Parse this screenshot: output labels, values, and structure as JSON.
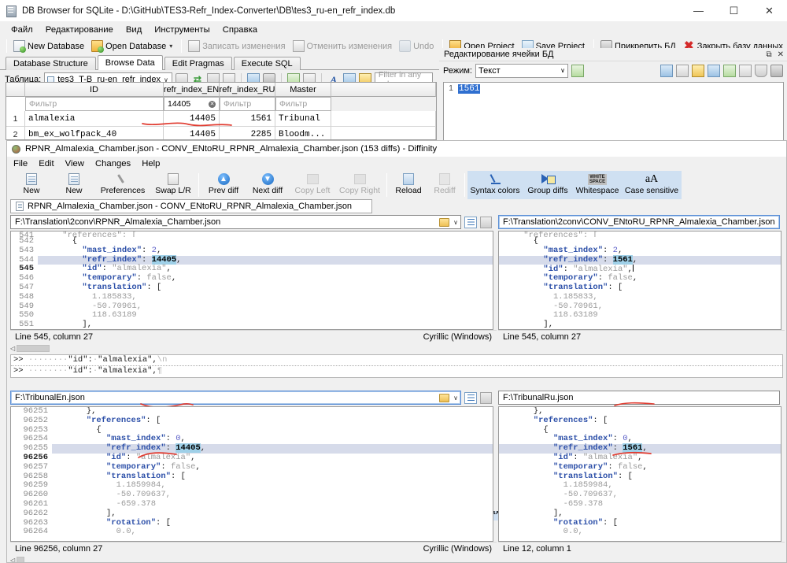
{
  "sqlite": {
    "title": "DB Browser for SQLite - D:\\GitHub\\TES3-Refr_Index-Converter\\DB\\tes3_ru-en_refr_index.db",
    "window_buttons": {
      "minimize": "—",
      "maximize": "☐",
      "close": "✕"
    },
    "menu": [
      "Файл",
      "Редактирование",
      "Вид",
      "Инструменты",
      "Справка"
    ],
    "toolbar": [
      {
        "label": "New Database",
        "icon": "new-database-icon"
      },
      {
        "label": "Open Database",
        "icon": "open-database-icon",
        "caret": "▾"
      },
      {
        "label": "Записать изменения",
        "icon": "write-changes-icon",
        "disabled": true
      },
      {
        "label": "Отменить изменения",
        "icon": "revert-changes-icon",
        "disabled": true
      },
      {
        "label": "Undo",
        "icon": "undo-icon",
        "disabled": true
      },
      {
        "label": "Open Project",
        "icon": "open-project-icon"
      },
      {
        "label": "Save Project",
        "icon": "save-project-icon"
      },
      {
        "label": "Прикрепить БД",
        "icon": "attach-database-icon"
      },
      {
        "label": "Закрыть базу данных",
        "icon": "close-database-icon"
      }
    ],
    "tabs": [
      {
        "label": "Database Structure",
        "active": false
      },
      {
        "label": "Browse Data",
        "active": true
      },
      {
        "label": "Edit Pragmas",
        "active": false
      },
      {
        "label": "Execute SQL",
        "active": false
      }
    ],
    "table_selector": {
      "label": "Таблица:",
      "value": "tes3_T-B_ru-en_refr_index",
      "caret": "∨"
    },
    "filter_any": {
      "placeholder": "Filter in any column",
      "value": ""
    },
    "grid": {
      "columns": [
        "ID",
        "refr_index_EN",
        "refr_index_RU",
        "Master"
      ],
      "filters": {
        "id": "Фильтр",
        "refr_index_en": "14405",
        "refr_index_ru": "Фильтр",
        "master": "Фильтр",
        "clear_glyph": "✕"
      },
      "rows": [
        {
          "n": "1",
          "id": "almalexia",
          "en": "14405",
          "ru": "1561",
          "master": "Tribunal"
        },
        {
          "n": "2",
          "id": "bm_ex_wolfpack_40",
          "en": "14405",
          "ru": "2285",
          "master": "Bloodm..."
        }
      ]
    },
    "cell_editor": {
      "title": "Редактирование ячейки БД",
      "undock_glyph": "⧉",
      "close_glyph": "✕",
      "mode_label": "Режим:",
      "mode_value": "Текст",
      "mode_caret": "∨",
      "line_number": "1",
      "content": "1561"
    }
  },
  "diffinity": {
    "title": "RPNR_Almalexia_Chamber.json - CONV_ENtoRU_RPNR_Almalexia_Chamber.json (153 diffs) - Diffinity",
    "menu": [
      "File",
      "Edit",
      "View",
      "Changes",
      "Help"
    ],
    "toolbar": [
      {
        "label": "New",
        "icon": "new-left-icon",
        "state": "normal"
      },
      {
        "label": "New",
        "icon": "new-right-icon",
        "state": "normal"
      },
      {
        "label": "Preferences",
        "icon": "wrench-icon",
        "state": "normal"
      },
      {
        "label": "Swap L/R",
        "icon": "swap-icon",
        "state": "normal"
      },
      {
        "label": "Prev diff",
        "icon": "arrow-up-icon",
        "state": "normal"
      },
      {
        "label": "Next diff",
        "icon": "arrow-down-icon",
        "state": "normal"
      },
      {
        "label": "Copy Left",
        "icon": "copy-left-icon",
        "state": "disabled"
      },
      {
        "label": "Copy Right",
        "icon": "copy-right-icon",
        "state": "disabled"
      },
      {
        "label": "Reload",
        "icon": "reload-icon",
        "state": "normal"
      },
      {
        "label": "Rediff",
        "icon": "rediff-icon",
        "state": "disabled"
      },
      {
        "label": "Syntax colors",
        "icon": "syntax-colors-icon",
        "state": "toggled"
      },
      {
        "label": "Group diffs",
        "icon": "group-diffs-icon",
        "state": "toggled"
      },
      {
        "label": "Whitespace",
        "icon": "whitespace-icon",
        "state": "toggled"
      },
      {
        "label": "Case sensitive",
        "icon": "case-sensitive-icon",
        "state": "toggled"
      }
    ],
    "doc_tab": "RPNR_Almalexia_Chamber.json - CONV_ENtoRU_RPNR_Almalexia_Chamber.json",
    "top": {
      "left": {
        "path": "F:\\Translation\\2conv\\RPNR_Almalexia_Chamber.json",
        "status_line": "Line 545, column 27",
        "encoding": "Cyrillic (Windows)",
        "lines": [
          {
            "no": "541",
            "clipped": true,
            "tokens": [
              [
                "s",
                "    \"references\": ["
              ]
            ]
          },
          {
            "no": "542",
            "tokens": [
              [
                "p",
                "      {"
              ]
            ]
          },
          {
            "no": "543",
            "tokens": [
              [
                "k",
                "        \"mast_index\""
              ],
              [
                "p",
                ": "
              ],
              [
                "n",
                "2"
              ],
              [
                "p",
                ","
              ]
            ]
          },
          {
            "no": "544",
            "highlight": true,
            "tokens": [
              [
                "k",
                "        \"refr_index\""
              ],
              [
                "p",
                ": "
              ],
              [
                "hl",
                "14405"
              ],
              [
                "p",
                ","
              ]
            ]
          },
          {
            "no": "545",
            "bold": true,
            "tokens": [
              [
                "k",
                "        \"id\""
              ],
              [
                "p",
                ": "
              ],
              [
                "s",
                "\"almalexia\""
              ],
              [
                "p",
                ","
              ]
            ]
          },
          {
            "no": "546",
            "tokens": [
              [
                "k",
                "        \"temporary\""
              ],
              [
                "p",
                ": "
              ],
              [
                "s",
                "false"
              ],
              [
                "p",
                ","
              ]
            ]
          },
          {
            "no": "547",
            "tokens": [
              [
                "k",
                "        \"translation\""
              ],
              [
                "p",
                ": ["
              ]
            ]
          },
          {
            "no": "548",
            "tokens": [
              [
                "s",
                "          1.185833,"
              ]
            ]
          },
          {
            "no": "549",
            "tokens": [
              [
                "s",
                "          -50.70961,"
              ]
            ]
          },
          {
            "no": "550",
            "tokens": [
              [
                "s",
                "          118.63189"
              ]
            ]
          },
          {
            "no": "551",
            "tokens": [
              [
                "p",
                "        ],"
              ]
            ]
          }
        ]
      },
      "right": {
        "path": "F:\\Translation\\2conv\\CONV_ENtoRU_RPNR_Almalexia_Chamber.json",
        "status_line": "Line 545, column 27",
        "lines": [
          {
            "no": "",
            "clipped": true,
            "tokens": [
              [
                "s",
                "    \"references\": ["
              ]
            ]
          },
          {
            "no": "",
            "tokens": [
              [
                "p",
                "      {"
              ]
            ]
          },
          {
            "no": "",
            "tokens": [
              [
                "k",
                "        \"mast_index\""
              ],
              [
                "p",
                ": "
              ],
              [
                "n",
                "2"
              ],
              [
                "p",
                ","
              ]
            ]
          },
          {
            "no": "",
            "highlight": true,
            "tokens": [
              [
                "k",
                "        \"refr_index\""
              ],
              [
                "p",
                ": "
              ],
              [
                "hl",
                "1561"
              ],
              [
                "p",
                ","
              ]
            ]
          },
          {
            "no": "",
            "tokens": [
              [
                "k",
                "        \"id\""
              ],
              [
                "p",
                ": "
              ],
              [
                "s",
                "\"almalexia\""
              ],
              [
                "p",
                ","
              ]
            ]
          },
          {
            "no": "",
            "tokens": [
              [
                "k",
                "        \"temporary\""
              ],
              [
                "p",
                ": "
              ],
              [
                "s",
                "false"
              ],
              [
                "p",
                ","
              ]
            ]
          },
          {
            "no": "",
            "tokens": [
              [
                "k",
                "        \"translation\""
              ],
              [
                "p",
                ": ["
              ]
            ]
          },
          {
            "no": "",
            "tokens": [
              [
                "s",
                "          1.185833,"
              ]
            ]
          },
          {
            "no": "",
            "tokens": [
              [
                "s",
                "          -50.70961,"
              ]
            ]
          },
          {
            "no": "",
            "tokens": [
              [
                "s",
                "          118.63189"
              ]
            ]
          },
          {
            "no": "",
            "tokens": [
              [
                "p",
                "        ],"
              ]
            ]
          }
        ]
      }
    },
    "inline_compare": [
      ">> ········\"id\":·\"almalexia\",\\n",
      ">> ········\"id\":·\"almalexia\",¶"
    ],
    "bottom": {
      "left": {
        "path": "F:\\TribunalEn.json",
        "status_line": "Line 96256, column 27",
        "encoding": "Cyrillic (Windows)",
        "lines": [
          {
            "no": "96251",
            "tokens": [
              [
                "p",
                "      },"
              ]
            ]
          },
          {
            "no": "96252",
            "tokens": [
              [
                "k",
                "      \"references\""
              ],
              [
                "p",
                ": ["
              ]
            ]
          },
          {
            "no": "96253",
            "tokens": [
              [
                "p",
                "        {"
              ]
            ]
          },
          {
            "no": "96254",
            "tokens": [
              [
                "k",
                "          \"mast_index\""
              ],
              [
                "p",
                ": "
              ],
              [
                "n",
                "0"
              ],
              [
                "p",
                ","
              ]
            ]
          },
          {
            "no": "96255",
            "highlight": true,
            "tokens": [
              [
                "k",
                "          \"refr_index\""
              ],
              [
                "p",
                ": "
              ],
              [
                "hl",
                "14405"
              ],
              [
                "p",
                ","
              ]
            ]
          },
          {
            "no": "96256",
            "bold": true,
            "tokens": [
              [
                "k",
                "          \"id\""
              ],
              [
                "p",
                ": "
              ],
              [
                "s",
                "\"almalexia\""
              ],
              [
                "p",
                ","
              ]
            ]
          },
          {
            "no": "96257",
            "tokens": [
              [
                "k",
                "          \"temporary\""
              ],
              [
                "p",
                ": "
              ],
              [
                "s",
                "false"
              ],
              [
                "p",
                ","
              ]
            ]
          },
          {
            "no": "96258",
            "tokens": [
              [
                "k",
                "          \"translation\""
              ],
              [
                "p",
                ": ["
              ]
            ]
          },
          {
            "no": "96259",
            "tokens": [
              [
                "s",
                "            1.1859984,"
              ]
            ]
          },
          {
            "no": "96260",
            "tokens": [
              [
                "s",
                "            -50.709637,"
              ]
            ]
          },
          {
            "no": "96261",
            "tokens": [
              [
                "s",
                "            -659.378"
              ]
            ]
          },
          {
            "no": "96262",
            "tokens": [
              [
                "p",
                "          ],"
              ]
            ]
          },
          {
            "no": "96263",
            "tokens": [
              [
                "k",
                "          \"rotation\""
              ],
              [
                "p",
                ": ["
              ]
            ]
          },
          {
            "no": "96264",
            "tokens": [
              [
                "s",
                "            0.0,"
              ]
            ]
          }
        ]
      },
      "right": {
        "path": "F:\\TribunalRu.json",
        "status_line": "Line 12, column 1",
        "lines": [
          {
            "no": "",
            "tokens": [
              [
                "p",
                "      },"
              ]
            ]
          },
          {
            "no": "",
            "tokens": [
              [
                "k",
                "      \"references\""
              ],
              [
                "p",
                ": ["
              ]
            ]
          },
          {
            "no": "",
            "tokens": [
              [
                "p",
                "        {"
              ]
            ]
          },
          {
            "no": "",
            "tokens": [
              [
                "k",
                "          \"mast_index\""
              ],
              [
                "p",
                ": "
              ],
              [
                "n",
                "0"
              ],
              [
                "p",
                ","
              ]
            ]
          },
          {
            "no": "",
            "highlight": true,
            "tokens": [
              [
                "k",
                "          \"refr_index\""
              ],
              [
                "p",
                ": "
              ],
              [
                "hl",
                "1561"
              ],
              [
                "p",
                ","
              ]
            ]
          },
          {
            "no": "",
            "tokens": [
              [
                "k",
                "          \"id\""
              ],
              [
                "p",
                ": "
              ],
              [
                "s",
                "\"almalexia\""
              ],
              [
                "p",
                ","
              ]
            ]
          },
          {
            "no": "",
            "tokens": [
              [
                "k",
                "          \"temporary\""
              ],
              [
                "p",
                ": "
              ],
              [
                "s",
                "false"
              ],
              [
                "p",
                ","
              ]
            ]
          },
          {
            "no": "",
            "tokens": [
              [
                "k",
                "          \"translation\""
              ],
              [
                "p",
                ": ["
              ]
            ]
          },
          {
            "no": "",
            "tokens": [
              [
                "s",
                "            1.1859984,"
              ]
            ]
          },
          {
            "no": "",
            "tokens": [
              [
                "s",
                "            -50.709637,"
              ]
            ]
          },
          {
            "no": "",
            "tokens": [
              [
                "s",
                "            -659.378"
              ]
            ]
          },
          {
            "no": "",
            "tokens": [
              [
                "p",
                "          ],"
              ]
            ]
          },
          {
            "no": "",
            "tokens": [
              [
                "k",
                "          \"rotation\""
              ],
              [
                "p",
                ": ["
              ]
            ]
          },
          {
            "no": "",
            "tokens": [
              [
                "s",
                "            0.0,"
              ]
            ]
          }
        ]
      }
    }
  },
  "colors": {
    "highlight_row": "#d6dbea",
    "token_highlight": "#9fd0e8",
    "toolbar_toggle": "#cfe0f2",
    "annotation_red": "#e03a2f",
    "selection_blue": "#2f6fd0"
  }
}
